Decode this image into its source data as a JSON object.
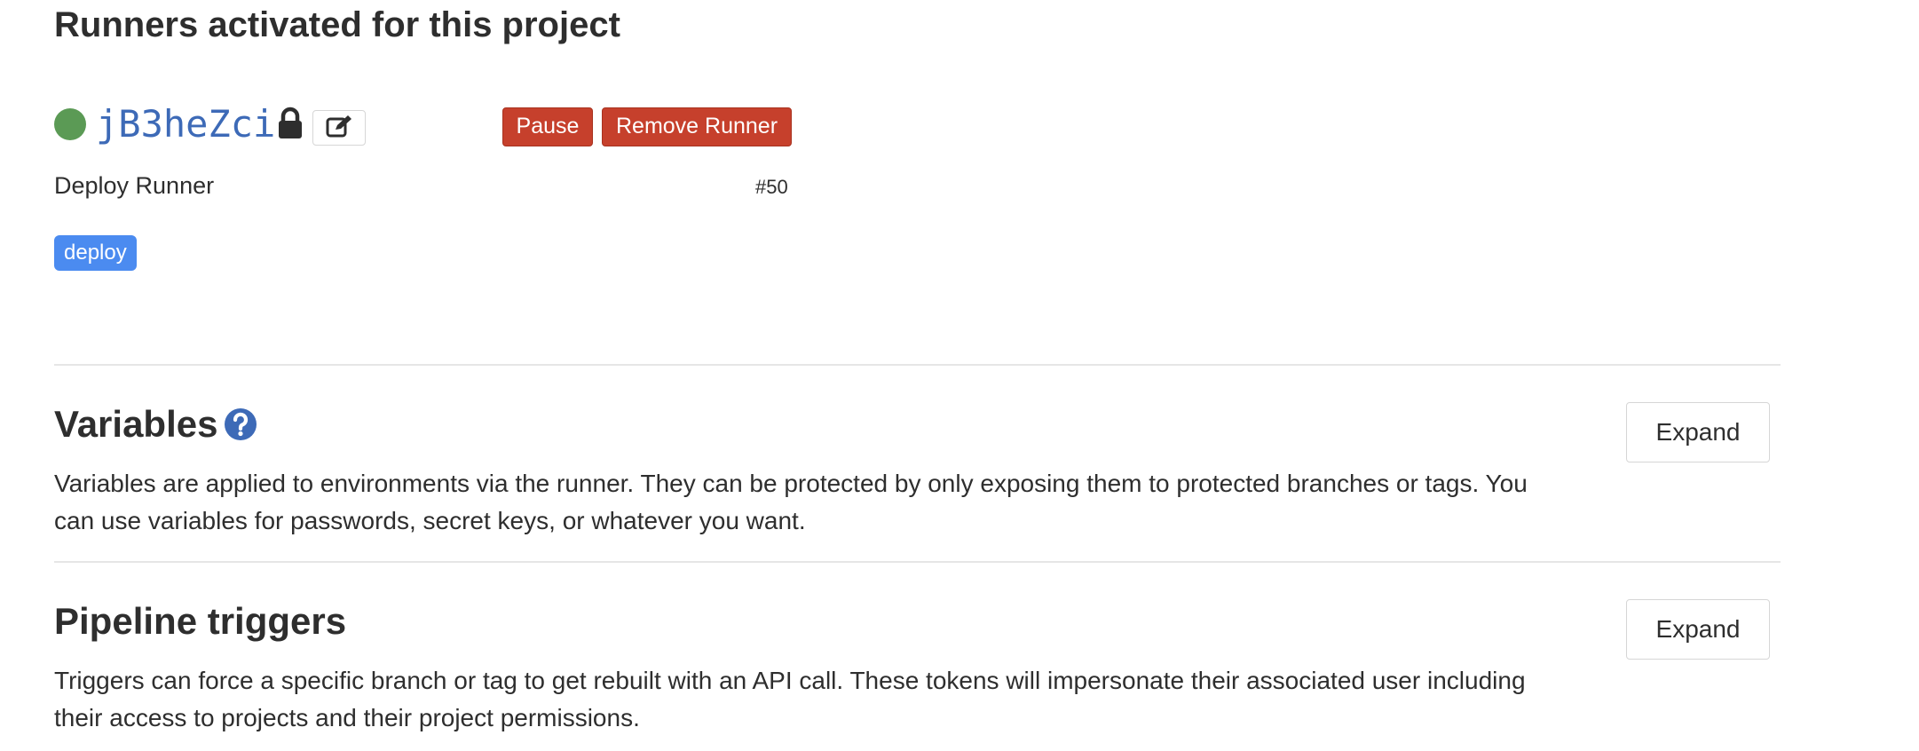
{
  "runners": {
    "title": "Runners activated for this project",
    "runner": {
      "token": "jB3heZci",
      "description": "Deploy Runner",
      "id": "#50",
      "tags": [
        "deploy"
      ],
      "status_color": "#5b9a55",
      "pause_label": "Pause",
      "remove_label": "Remove Runner",
      "icons": [
        "lock-icon",
        "edit-icon"
      ]
    }
  },
  "variables": {
    "title": "Variables",
    "help_icon": "question-circle-icon",
    "description": "Variables are applied to environments via the runner. They can be protected by only exposing them to protected branches or tags. You can use variables for passwords, secret keys, or whatever you want.",
    "expand_label": "Expand"
  },
  "pipeline_triggers": {
    "title": "Pipeline triggers",
    "description": "Triggers can force a specific branch or tag to get rebuilt with an API call. These tokens will impersonate their associated user including their access to projects and their project permissions.",
    "expand_label": "Expand"
  },
  "colors": {
    "danger": "#c6402c",
    "tag": "#4b8bf0",
    "link": "#3d6ab7",
    "help_icon": "#3d6ab7"
  }
}
